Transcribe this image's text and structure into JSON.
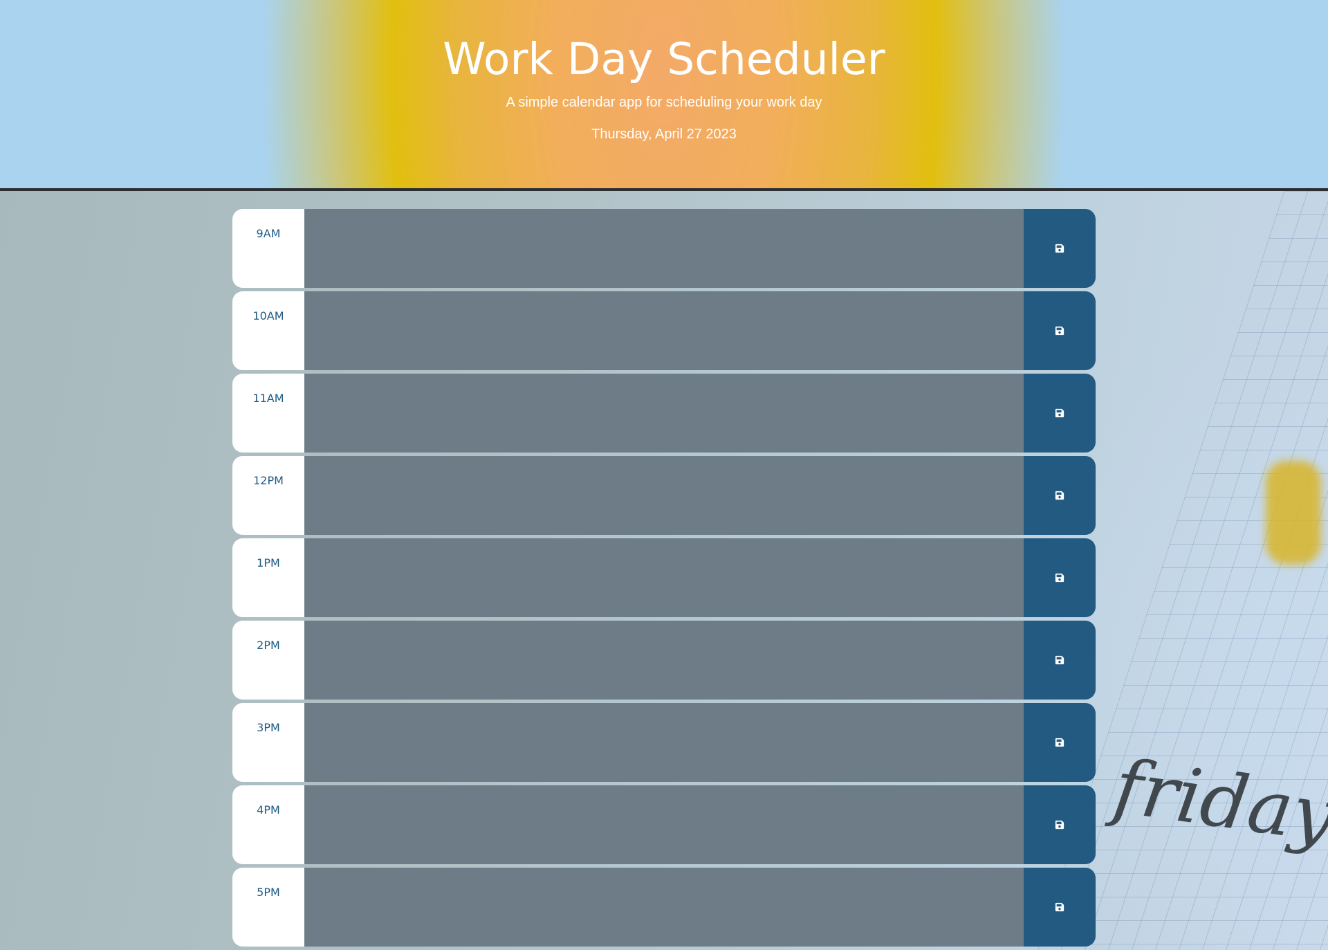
{
  "header": {
    "title": "Work Day Scheduler",
    "subtitle": "A simple calendar app for scheduling your work day",
    "current_date": "Thursday, April 27 2023"
  },
  "colors": {
    "hour_label": "#1f5b84",
    "past_block": "#6d7c86",
    "save_button": "#225a82",
    "header_center": "#f3aa68",
    "header_edge": "#a9d3ee"
  },
  "background_text": "friday",
  "time_blocks": [
    {
      "hour": "9AM",
      "description": "",
      "state": "past",
      "save_icon": "floppy-disk-icon"
    },
    {
      "hour": "10AM",
      "description": "",
      "state": "past",
      "save_icon": "floppy-disk-icon"
    },
    {
      "hour": "11AM",
      "description": "",
      "state": "past",
      "save_icon": "floppy-disk-icon"
    },
    {
      "hour": "12PM",
      "description": "",
      "state": "past",
      "save_icon": "floppy-disk-icon"
    },
    {
      "hour": "1PM",
      "description": "",
      "state": "past",
      "save_icon": "floppy-disk-icon"
    },
    {
      "hour": "2PM",
      "description": "",
      "state": "past",
      "save_icon": "floppy-disk-icon"
    },
    {
      "hour": "3PM",
      "description": "",
      "state": "past",
      "save_icon": "floppy-disk-icon"
    },
    {
      "hour": "4PM",
      "description": "",
      "state": "past",
      "save_icon": "floppy-disk-icon"
    },
    {
      "hour": "5PM",
      "description": "",
      "state": "past",
      "save_icon": "floppy-disk-icon"
    }
  ]
}
